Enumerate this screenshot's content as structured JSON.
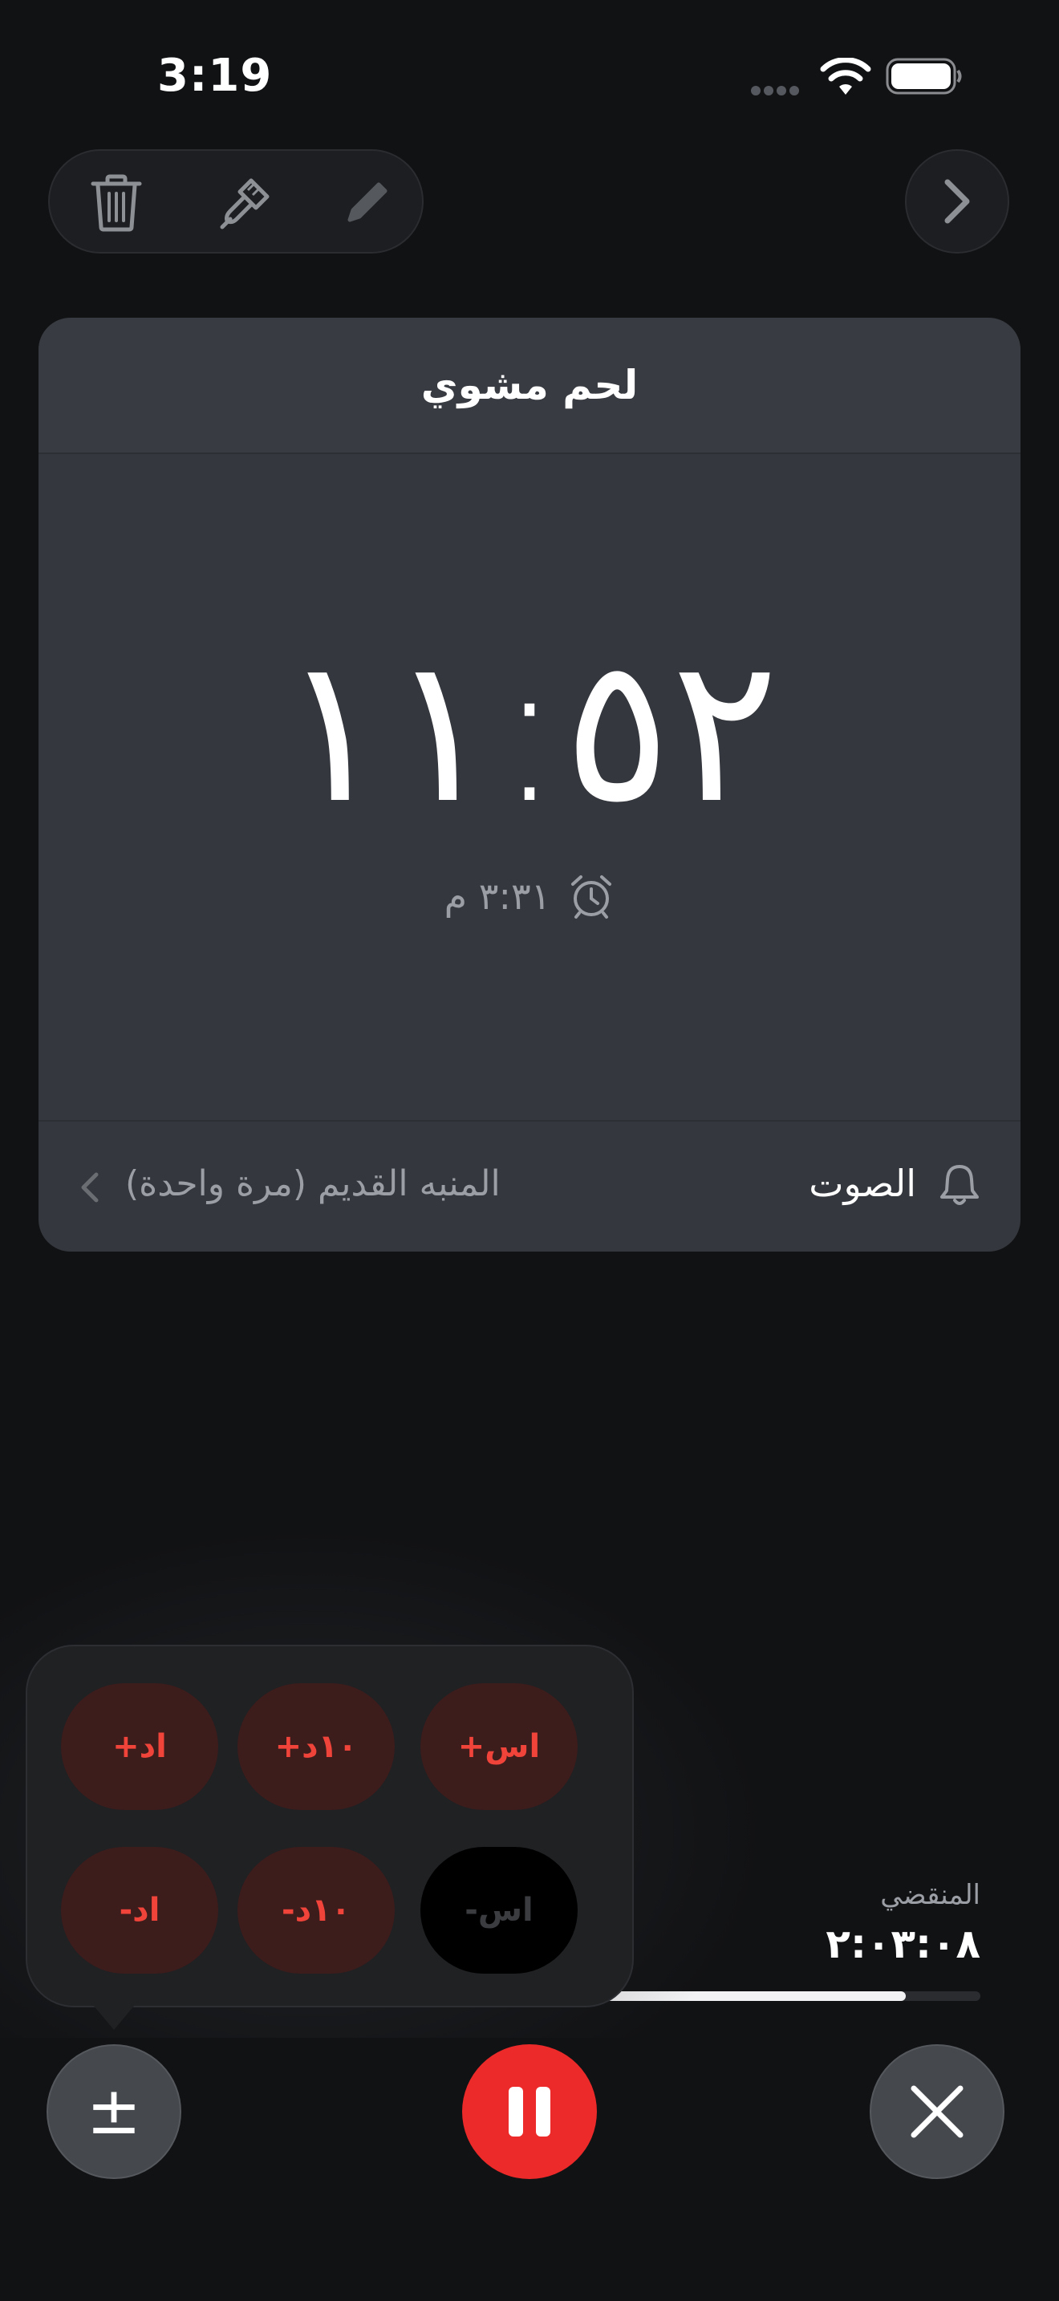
{
  "status_bar": {
    "time": "3:19"
  },
  "toolbar": {
    "delete_icon": "trash-icon",
    "style_icon": "paintbrush-icon",
    "edit_icon": "pencil-icon",
    "next_icon": "chevron-right-icon"
  },
  "timer": {
    "title": "لحم مشوي",
    "remaining": "١١:٥٢",
    "end_time": "٣:٣١ م",
    "sound_label": "الصوت",
    "sound_value": "المنبه القديم (مرة واحدة)"
  },
  "elapsed": {
    "label": "المنقضي",
    "value": "٢:٠٣:٠٨",
    "progress_fraction": 0.92
  },
  "adjust_popover": {
    "row1": [
      "+اس",
      "+١٠د",
      "+اد"
    ],
    "row2": [
      "-اس",
      "-١٠د",
      "-اد"
    ],
    "disabled": [
      "-اس"
    ]
  },
  "controls": {
    "adjust_symbol": "±",
    "pause_icon": "pause-icon",
    "cancel_icon": "close-icon"
  },
  "colors": {
    "accent_red": "#ec2a2a",
    "background": "#111214",
    "card": "#34373d"
  }
}
